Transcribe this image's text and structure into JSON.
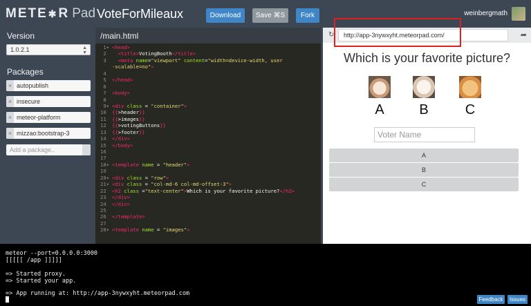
{
  "header": {
    "logo_main": "METE",
    "logo_star": "✱",
    "logo_r": "R",
    "logo_pad": "Pad",
    "title": "VoteForMileaux",
    "download_label": "Download",
    "save_label": "Save ⌘S",
    "fork_label": "Fork",
    "username": "weinbergmath"
  },
  "sidebar": {
    "version_heading": "Version",
    "version_value": "1.0.2.1",
    "packages_heading": "Packages",
    "packages": [
      "autopublish",
      "insecure",
      "meteor-platform",
      "mizzao:bootstrap-3"
    ],
    "add_placeholder": "Add a package.."
  },
  "editor": {
    "filename": "/main.html",
    "lines": [
      {
        "n": "1",
        "fold": true,
        "html": "<span class=\"t-tag\">&lt;head&gt;</span>"
      },
      {
        "n": "2",
        "fold": false,
        "html": "  <span class=\"t-tag\">&lt;title&gt;</span>VotingBooth<span class=\"t-tag\">&lt;/title&gt;</span>"
      },
      {
        "n": "3",
        "fold": false,
        "html": "  <span class=\"t-tag\">&lt;meta</span> <span class=\"t-attr\">name</span>=<span class=\"t-str\">\"viewport\"</span> <span class=\"t-attr\">content</span>=<span class=\"t-str\">\"width=device-width, user</span>"
      },
      {
        "n": "",
        "fold": false,
        "html": "<span class=\"t-str\">-scalable=no\"</span><span class=\"t-tag\">&gt;</span>"
      },
      {
        "n": "4",
        "fold": false,
        "html": ""
      },
      {
        "n": "5",
        "fold": false,
        "html": "<span class=\"t-tag\">&lt;/head&gt;</span>"
      },
      {
        "n": "6",
        "fold": false,
        "html": ""
      },
      {
        "n": "7",
        "fold": false,
        "html": "<span class=\"t-tag\">&lt;body&gt;</span>"
      },
      {
        "n": "8",
        "fold": false,
        "html": ""
      },
      {
        "n": "9",
        "fold": true,
        "html": "<span class=\"t-tag\">&lt;div</span> <span class=\"t-attr\">class</span> = <span class=\"t-str\">\"container\"</span><span class=\"t-tag\">&gt;</span>"
      },
      {
        "n": "10",
        "fold": false,
        "html": "<span class=\"t-br\">{{</span>&gt;header<span class=\"t-br\">}}</span>"
      },
      {
        "n": "11",
        "fold": false,
        "html": "<span class=\"t-br\">{{</span>&gt;images<span class=\"t-br\">}}</span>"
      },
      {
        "n": "12",
        "fold": false,
        "html": "<span class=\"t-br\">{{</span>&gt;votingButtons<span class=\"t-br\">}}</span>"
      },
      {
        "n": "13",
        "fold": false,
        "html": "<span class=\"t-br\">{{</span>&gt;footer<span class=\"t-br\">}}</span>"
      },
      {
        "n": "14",
        "fold": false,
        "html": "<span class=\"t-tag\">&lt;/div&gt;</span>"
      },
      {
        "n": "15",
        "fold": false,
        "html": "<span class=\"t-tag\">&lt;/body&gt;</span>"
      },
      {
        "n": "16",
        "fold": false,
        "html": ""
      },
      {
        "n": "17",
        "fold": false,
        "html": ""
      },
      {
        "n": "18",
        "fold": true,
        "html": "<span class=\"t-tag\">&lt;template</span> <span class=\"t-attr\">name</span> = <span class=\"t-str\">\"header\"</span><span class=\"t-tag\">&gt;</span>"
      },
      {
        "n": "19",
        "fold": false,
        "html": ""
      },
      {
        "n": "20",
        "fold": true,
        "html": "<span class=\"t-tag\">&lt;div</span> <span class=\"t-attr\">class</span> = <span class=\"t-str\">\"row\"</span><span class=\"t-tag\">&gt;</span>"
      },
      {
        "n": "21",
        "fold": true,
        "html": "<span class=\"t-tag\">&lt;div</span> <span class=\"t-attr\">class</span> = <span class=\"t-str\">\"col-md-6 col-md-offset-3\"</span><span class=\"t-tag\">&gt;</span>"
      },
      {
        "n": "22",
        "fold": false,
        "html": "<span class=\"t-tag\">&lt;h2</span> <span class=\"t-attr\">class</span> =<span class=\"t-str\">\"text-center\"</span><span class=\"t-tag\">&gt;</span>Which is your favorite picture?<span class=\"t-tag\">&lt;/h2&gt;</span>"
      },
      {
        "n": "23",
        "fold": false,
        "html": "<span class=\"t-tag\">&lt;/div&gt;</span>"
      },
      {
        "n": "24",
        "fold": false,
        "html": "<span class=\"t-tag\">&lt;/div&gt;</span>"
      },
      {
        "n": "25",
        "fold": false,
        "html": ""
      },
      {
        "n": "26",
        "fold": false,
        "html": "<span class=\"t-tag\">&lt;/template&gt;</span>"
      },
      {
        "n": "27",
        "fold": false,
        "html": ""
      },
      {
        "n": "28",
        "fold": true,
        "html": "<span class=\"t-tag\">&lt;template</span> <span class=\"t-attr\">name</span> = <span class=\"t-str\">\"images\"</span><span class=\"t-tag\">&gt;</span>"
      }
    ]
  },
  "preview": {
    "reload_icon": "↻",
    "url": "http://app-3nywxyht.meteorpad.com/",
    "share_icon": "➦",
    "question": "Which is your favorite picture?",
    "letters": [
      "A",
      "B",
      "C"
    ],
    "voter_placeholder": "Voter Name",
    "vote_buttons": [
      "A",
      "B",
      "C"
    ]
  },
  "console": {
    "lines": [
      "meteor --port=0.0.0.0:3000",
      "[[[[[ /app ]]]]]",
      "",
      "=> Started proxy.",
      "=> Started your app.",
      "",
      "=> App running at: http://app-3nywxyht.meteorpad.com"
    ],
    "feedback_label": "Feedback",
    "issues_label": "Issues"
  },
  "colors": {
    "chrome": "#3c4753",
    "accent": "#3f86c8",
    "highlight": "#e02020"
  }
}
